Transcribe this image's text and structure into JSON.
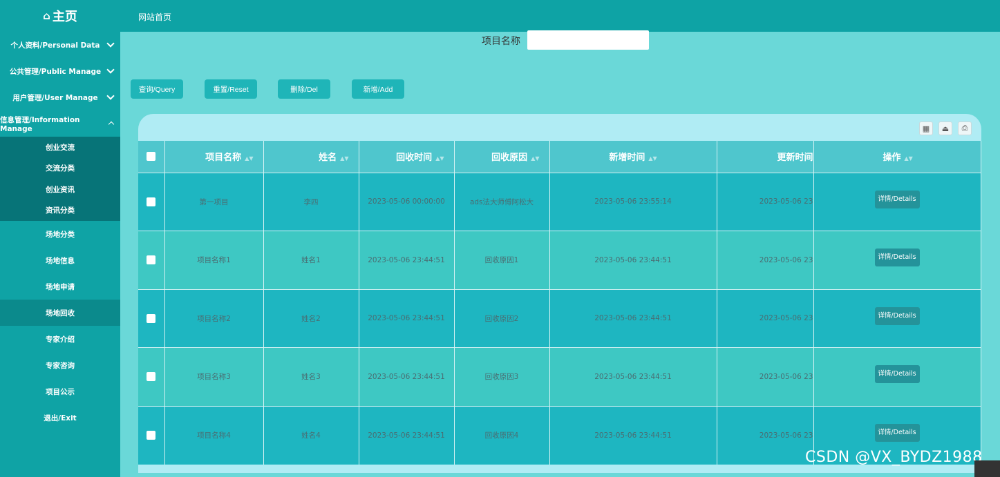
{
  "sidebar": {
    "brand": "主页",
    "brand_icon": "home-icon",
    "menus": [
      {
        "label": "个人资料/Personal Data"
      },
      {
        "label": "公共管理/Public Manage"
      },
      {
        "label": "用户管理/User Manage"
      },
      {
        "label": "信息管理/Information Manage"
      }
    ],
    "submenu": [
      "创业交流",
      "交流分类",
      "创业资讯",
      "资讯分类"
    ],
    "items": [
      "场地分类",
      "场地信息",
      "场地申请",
      "场地回收",
      "专家介绍",
      "专家咨询",
      "项目公示",
      "退出/Exit"
    ]
  },
  "topbar": {
    "site_home": "网站首页"
  },
  "search": {
    "label": "项目名称",
    "value": ""
  },
  "buttons": {
    "query": "查询/Query",
    "reset": "重置/Reset",
    "del": "删除/Del",
    "add": "新增/Add"
  },
  "table": {
    "headers": [
      "项目名称",
      "姓名",
      "回收时间",
      "回收原因",
      "新增时间",
      "更新时间",
      "操作"
    ],
    "rows": [
      {
        "name": "第一项目",
        "person": "李四",
        "recycle_time": "2023-05-06 00:00:00",
        "reason": "ads法大师傅阿松大",
        "create_time": "2023-05-06 23:55:14",
        "update_time": "2023-05-06 23",
        "op": "详情/Details"
      },
      {
        "name": "项目名称1",
        "person": "姓名1",
        "recycle_time": "2023-05-06 23:44:51",
        "reason": "回收原因1",
        "create_time": "2023-05-06 23:44:51",
        "update_time": "2023-05-06 23",
        "op": "详情/Details"
      },
      {
        "name": "项目名称2",
        "person": "姓名2",
        "recycle_time": "2023-05-06 23:44:51",
        "reason": "回收原因2",
        "create_time": "2023-05-06 23:44:51",
        "update_time": "2023-05-06 23",
        "op": "详情/Details"
      },
      {
        "name": "项目名称3",
        "person": "姓名3",
        "recycle_time": "2023-05-06 23:44:51",
        "reason": "回收原因3",
        "create_time": "2023-05-06 23:44:51",
        "update_time": "2023-05-06 23",
        "op": "详情/Details"
      },
      {
        "name": "项目名称4",
        "person": "姓名4",
        "recycle_time": "2023-05-06 23:44:51",
        "reason": "回收原因4",
        "create_time": "2023-05-06 23:44:51",
        "update_time": "2023-05-06 23",
        "op": "详情/Details"
      }
    ]
  },
  "toolbar_icons": [
    "grid-icon",
    "export-icon",
    "print-icon"
  ],
  "watermark": "CSDN @VX_BYDZ1988",
  "colors": {
    "sidebar": "#0fa3a5",
    "submenu": "#077478",
    "header_row": "#4fc6cd",
    "row_dark": "#1eb6c1",
    "row_light": "#3ec8c3",
    "detail_button": "#24939a"
  }
}
